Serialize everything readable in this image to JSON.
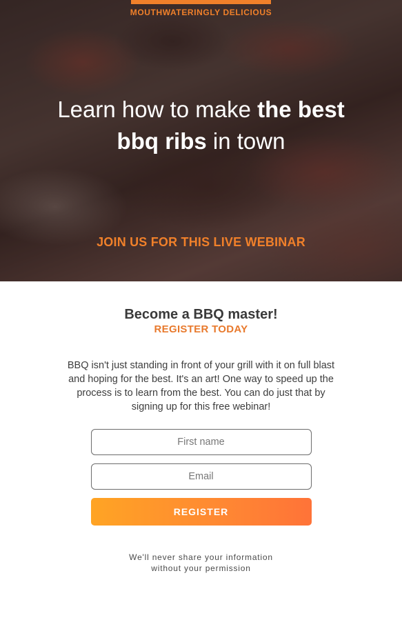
{
  "hero": {
    "tagline": "MOUTHWATERINGLY DELICIOUS",
    "headline_part1": "Learn how to make ",
    "headline_bold1": "the best",
    "headline_bold2": "bbq ribs",
    "headline_part2": " in town",
    "cta": "JOIN US FOR THIS LIVE WEBINAR",
    "accent_color": "#f0802a"
  },
  "section": {
    "title": "Become a BBQ master!",
    "subtitle": "REGISTER TODAY",
    "description": "BBQ isn't just standing in front of your grill with it on full blast and hoping for the best. It's an art! One way to speed up the process is to learn from the best. You can do just that by signing up for this free webinar!"
  },
  "form": {
    "first_name_placeholder": "First name",
    "email_placeholder": "Email",
    "register_label": "REGISTER",
    "button_gradient": [
      "#ffa424",
      "#ff7338"
    ]
  },
  "footer": {
    "privacy_line1": "We'll never share your information",
    "privacy_line2": "without your permission"
  }
}
